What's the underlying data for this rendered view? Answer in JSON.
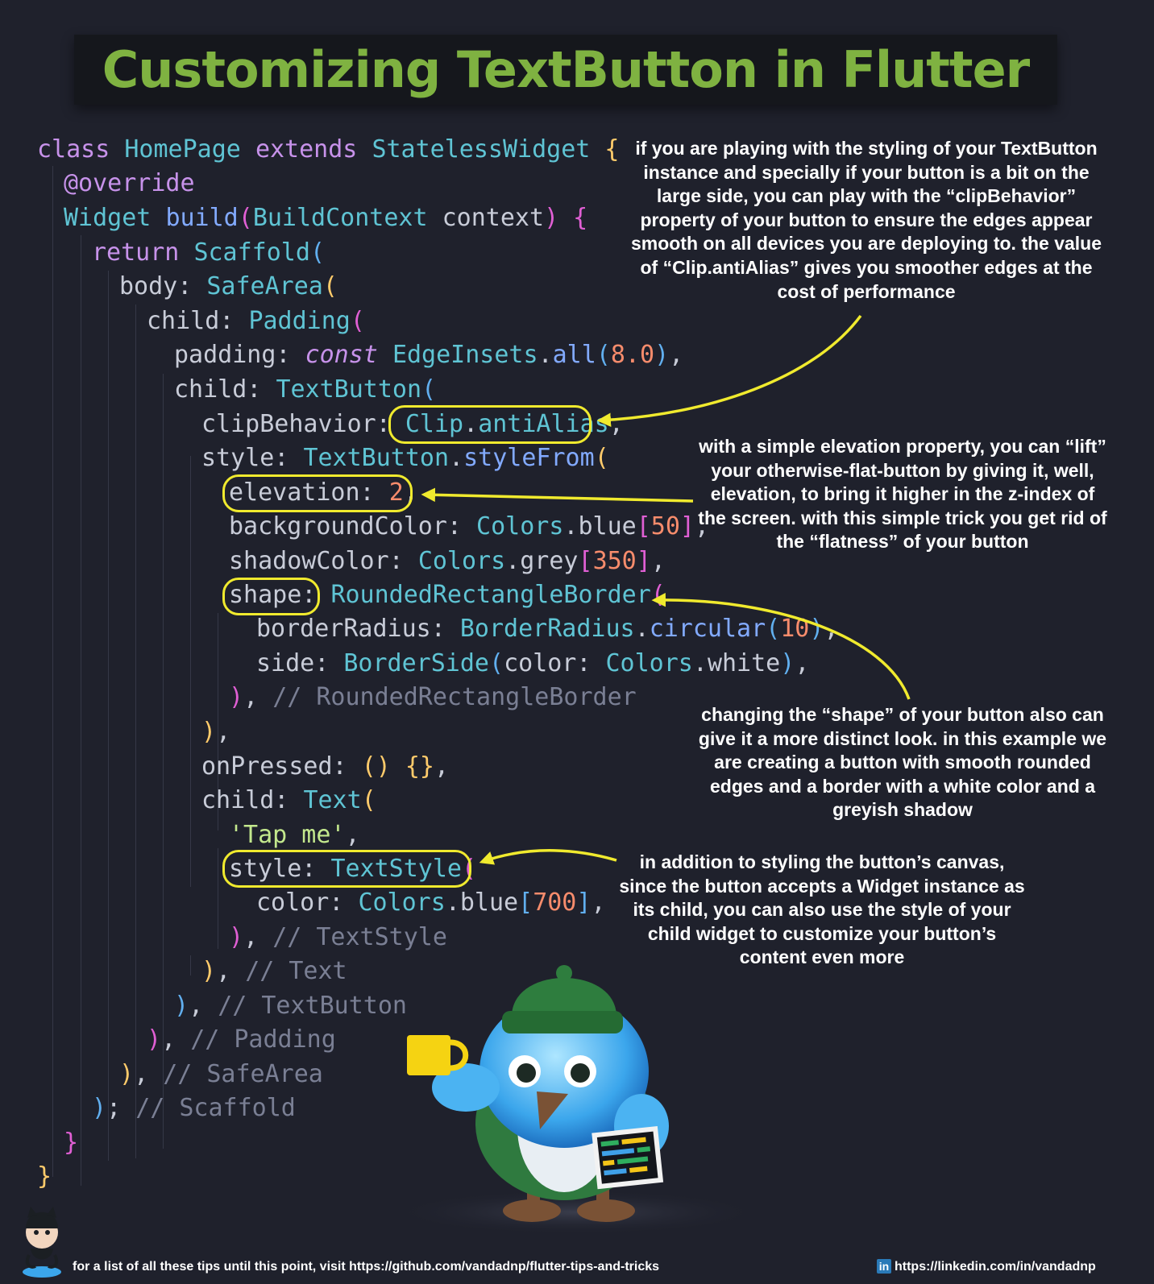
{
  "title": "Customizing TextButton in Flutter",
  "code_lines": [
    [
      [
        "class ",
        "kw"
      ],
      [
        "HomePage ",
        "ty"
      ],
      [
        "extends ",
        "kw"
      ],
      [
        "StatelessWidget ",
        "ty"
      ],
      [
        "{",
        "ky"
      ]
    ],
    [
      [
        "@override",
        "kw"
      ]
    ],
    [
      [
        "Widget ",
        "ty"
      ],
      [
        "build",
        "fn"
      ],
      [
        "(",
        "bm"
      ],
      [
        "BuildContext ",
        "ty"
      ],
      [
        "context",
        "pr"
      ],
      [
        ")",
        "bm"
      ],
      [
        " {",
        "bm"
      ]
    ],
    [
      [
        "return ",
        "kw"
      ],
      [
        "Scaffold",
        "ty"
      ],
      [
        "(",
        "bb"
      ]
    ],
    [
      [
        "body: ",
        "pr"
      ],
      [
        "SafeArea",
        "ty"
      ],
      [
        "(",
        "ky"
      ]
    ],
    [
      [
        "child: ",
        "pr"
      ],
      [
        "Padding",
        "ty"
      ],
      [
        "(",
        "bm"
      ]
    ],
    [
      [
        "padding: ",
        "pr"
      ],
      [
        "const ",
        "it"
      ],
      [
        "EdgeInsets",
        "ty"
      ],
      [
        ".",
        "pr"
      ],
      [
        "all",
        "fn"
      ],
      [
        "(",
        "bb"
      ],
      [
        "8.0",
        "nm"
      ],
      [
        ")",
        "bb"
      ],
      [
        ",",
        "pr"
      ]
    ],
    [
      [
        "child: ",
        "pr"
      ],
      [
        "TextButton",
        "ty"
      ],
      [
        "(",
        "bb"
      ]
    ],
    [
      [
        "clipBehavior: ",
        "pr"
      ],
      [
        "Clip",
        "ty"
      ],
      [
        ".",
        "pr"
      ],
      [
        "antiAlias",
        "ty"
      ],
      [
        ",",
        "pr"
      ]
    ],
    [
      [
        "style: ",
        "pr"
      ],
      [
        "TextButton",
        "ty"
      ],
      [
        ".",
        "pr"
      ],
      [
        "styleFrom",
        "fn"
      ],
      [
        "(",
        "ky"
      ]
    ],
    [
      [
        "elevation: ",
        "pr"
      ],
      [
        "2",
        "nm"
      ],
      [
        ",",
        "pr"
      ]
    ],
    [
      [
        "backgroundColor: ",
        "pr"
      ],
      [
        "Colors",
        "ty"
      ],
      [
        ".",
        "pr"
      ],
      [
        "blue",
        "pr"
      ],
      [
        "[",
        "bm"
      ],
      [
        "50",
        "nm"
      ],
      [
        "]",
        "bm"
      ],
      [
        ",",
        "pr"
      ]
    ],
    [
      [
        "shadowColor: ",
        "pr"
      ],
      [
        "Colors",
        "ty"
      ],
      [
        ".",
        "pr"
      ],
      [
        "grey",
        "pr"
      ],
      [
        "[",
        "bm"
      ],
      [
        "350",
        "nm"
      ],
      [
        "]",
        "bm"
      ],
      [
        ",",
        "pr"
      ]
    ],
    [
      [
        "shape: ",
        "pr"
      ],
      [
        "RoundedRectangleBorder",
        "ty"
      ],
      [
        "(",
        "bm"
      ]
    ],
    [
      [
        "borderRadius: ",
        "pr"
      ],
      [
        "BorderRadius",
        "ty"
      ],
      [
        ".",
        "pr"
      ],
      [
        "circular",
        "fn"
      ],
      [
        "(",
        "bb"
      ],
      [
        "10",
        "nm"
      ],
      [
        ")",
        "bb"
      ],
      [
        ",",
        "pr"
      ]
    ],
    [
      [
        "side: ",
        "pr"
      ],
      [
        "BorderSide",
        "ty"
      ],
      [
        "(",
        "bb"
      ],
      [
        "color: ",
        "pr"
      ],
      [
        "Colors",
        "ty"
      ],
      [
        ".",
        "pr"
      ],
      [
        "white",
        "pr"
      ],
      [
        ")",
        "bb"
      ],
      [
        ",",
        "pr"
      ]
    ],
    [
      [
        ")",
        "bm"
      ],
      [
        ", ",
        "pr"
      ],
      [
        "// RoundedRectangleBorder",
        "cm"
      ]
    ],
    [
      [
        ")",
        "ky"
      ],
      [
        ",",
        "pr"
      ]
    ],
    [
      [
        "onPressed: ",
        "pr"
      ],
      [
        "()",
        "ky"
      ],
      [
        " {}",
        "ky"
      ],
      [
        ",",
        "pr"
      ]
    ],
    [
      [
        "child: ",
        "pr"
      ],
      [
        "Text",
        "ty"
      ],
      [
        "(",
        "ky"
      ]
    ],
    [
      [
        "'Tap me'",
        "st"
      ],
      [
        ",",
        "pr"
      ]
    ],
    [
      [
        "style: ",
        "pr"
      ],
      [
        "TextStyle",
        "ty"
      ],
      [
        "(",
        "bm"
      ]
    ],
    [
      [
        "color: ",
        "pr"
      ],
      [
        "Colors",
        "ty"
      ],
      [
        ".",
        "pr"
      ],
      [
        "blue",
        "pr"
      ],
      [
        "[",
        "bb"
      ],
      [
        "700",
        "nm"
      ],
      [
        "]",
        "bb"
      ],
      [
        ",",
        "pr"
      ]
    ],
    [
      [
        ")",
        "bm"
      ],
      [
        ", ",
        "pr"
      ],
      [
        "// TextStyle",
        "cm"
      ]
    ],
    [
      [
        ")",
        "ky"
      ],
      [
        ", ",
        "pr"
      ],
      [
        "// Text",
        "cm"
      ]
    ],
    [
      [
        ")",
        "bb"
      ],
      [
        ", ",
        "pr"
      ],
      [
        "// TextButton",
        "cm"
      ]
    ],
    [
      [
        ")",
        "bm"
      ],
      [
        ", ",
        "pr"
      ],
      [
        "// Padding",
        "cm"
      ]
    ],
    [
      [
        ")",
        "ky"
      ],
      [
        ", ",
        "pr"
      ],
      [
        "// SafeArea",
        "cm"
      ]
    ],
    [
      [
        ")",
        "bb"
      ],
      [
        "; ",
        "pr"
      ],
      [
        "// Scaffold",
        "cm"
      ]
    ],
    [
      [
        "}",
        "bm"
      ]
    ],
    [
      [
        "}",
        "ky"
      ]
    ]
  ],
  "notes": {
    "clip": "if you are playing with the styling of your TextButton instance and specially if your button is a bit on the large side, you can play with the “clipBehavior” property of your button to ensure the edges appear smooth on all devices you are deploying to. the value of “Clip.antiAlias” gives you smoother edges at the cost of performance",
    "elevation": "with a simple elevation property, you can “lift” your otherwise-flat-button by giving it, well, elevation, to bring it higher in the z-index of the screen. with this simple trick you get rid of the “flatness” of your button",
    "shape": "changing the “shape” of your button also can give it a more distinct look. in this example we are creating a button with smooth rounded edges and a border with a white color and a greyish shadow",
    "style": "in addition to styling the button’s canvas, since the button accepts a Widget instance as its child, you can also use the style of your child widget to customize your button’s content even more"
  },
  "footer": {
    "left_text": "for a list of all these tips until this point, visit https://github.com/vandadnp/flutter-tips-and-tricks",
    "linkedin_badge": "in",
    "right_text": "https://linkedin.com/in/vandadnp"
  },
  "colors": {
    "background": "#1f212c",
    "title": "#7fb241",
    "highlight": "#f0ea2e",
    "arrow": "#f0ea2e"
  },
  "icons": {
    "mascot": "dash-bird-mascot",
    "github": "octocat-icon",
    "linkedin": "linkedin-icon"
  }
}
